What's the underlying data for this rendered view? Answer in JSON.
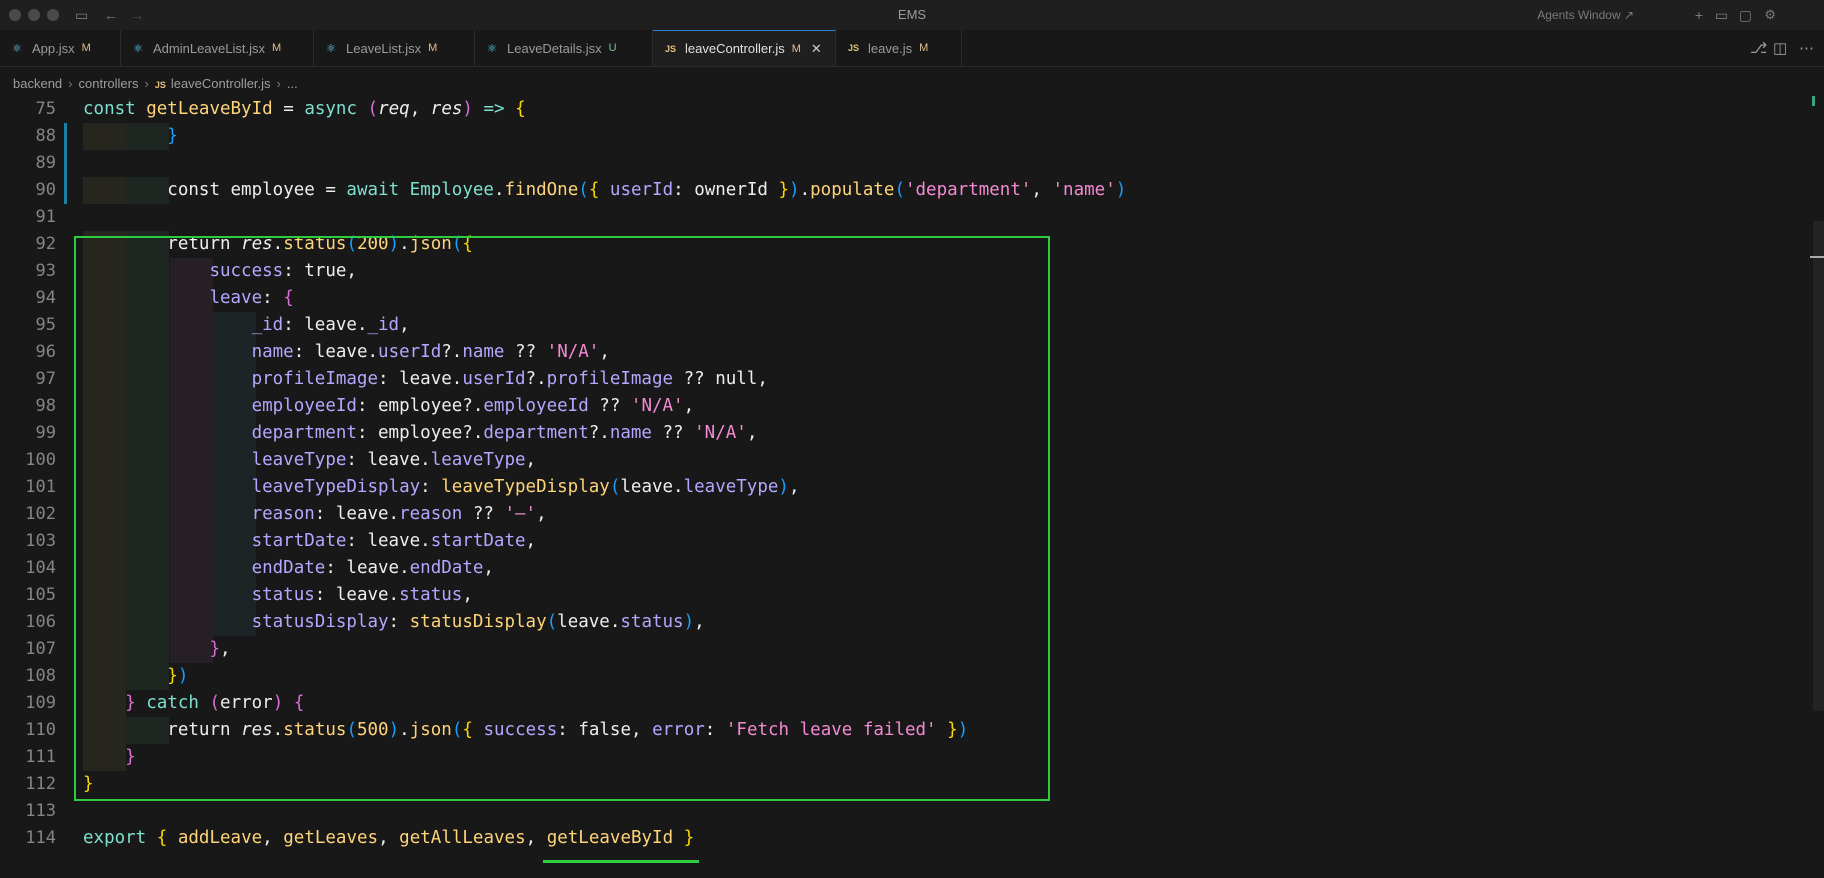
{
  "window": {
    "title": "EMS",
    "agents_label": "Agents Window ↗"
  },
  "tabs": [
    {
      "label": "App.jsx",
      "status": "M",
      "icon": "react-icon"
    },
    {
      "label": "AdminLeaveList.jsx",
      "status": "M",
      "icon": "react-icon"
    },
    {
      "label": "LeaveList.jsx",
      "status": "M",
      "icon": "react-icon"
    },
    {
      "label": "LeaveDetails.jsx",
      "status": "U",
      "icon": "react-icon"
    },
    {
      "label": "leaveController.js",
      "status": "M",
      "icon": "js-icon",
      "active": true
    },
    {
      "label": "leave.js",
      "status": "M",
      "icon": "js-icon"
    }
  ],
  "breadcrumb": {
    "folder1": "backend",
    "folder2": "controllers",
    "file": "leaveController.js",
    "more": "...",
    "file_badge": "JS"
  },
  "icons": {
    "react": "⚛",
    "close": "✕"
  },
  "editor": {
    "line_numbers": [
      "75",
      "88",
      "89",
      "90",
      "91",
      "92",
      "93",
      "94",
      "95",
      "96",
      "97",
      "98",
      "99",
      "100",
      "101",
      "102",
      "103",
      "104",
      "105",
      "106",
      "107",
      "108",
      "109",
      "110",
      "111",
      "112",
      "113",
      "114"
    ]
  },
  "colors": {
    "highlight": "#2ecc40",
    "accent": "#2f7fd6"
  }
}
